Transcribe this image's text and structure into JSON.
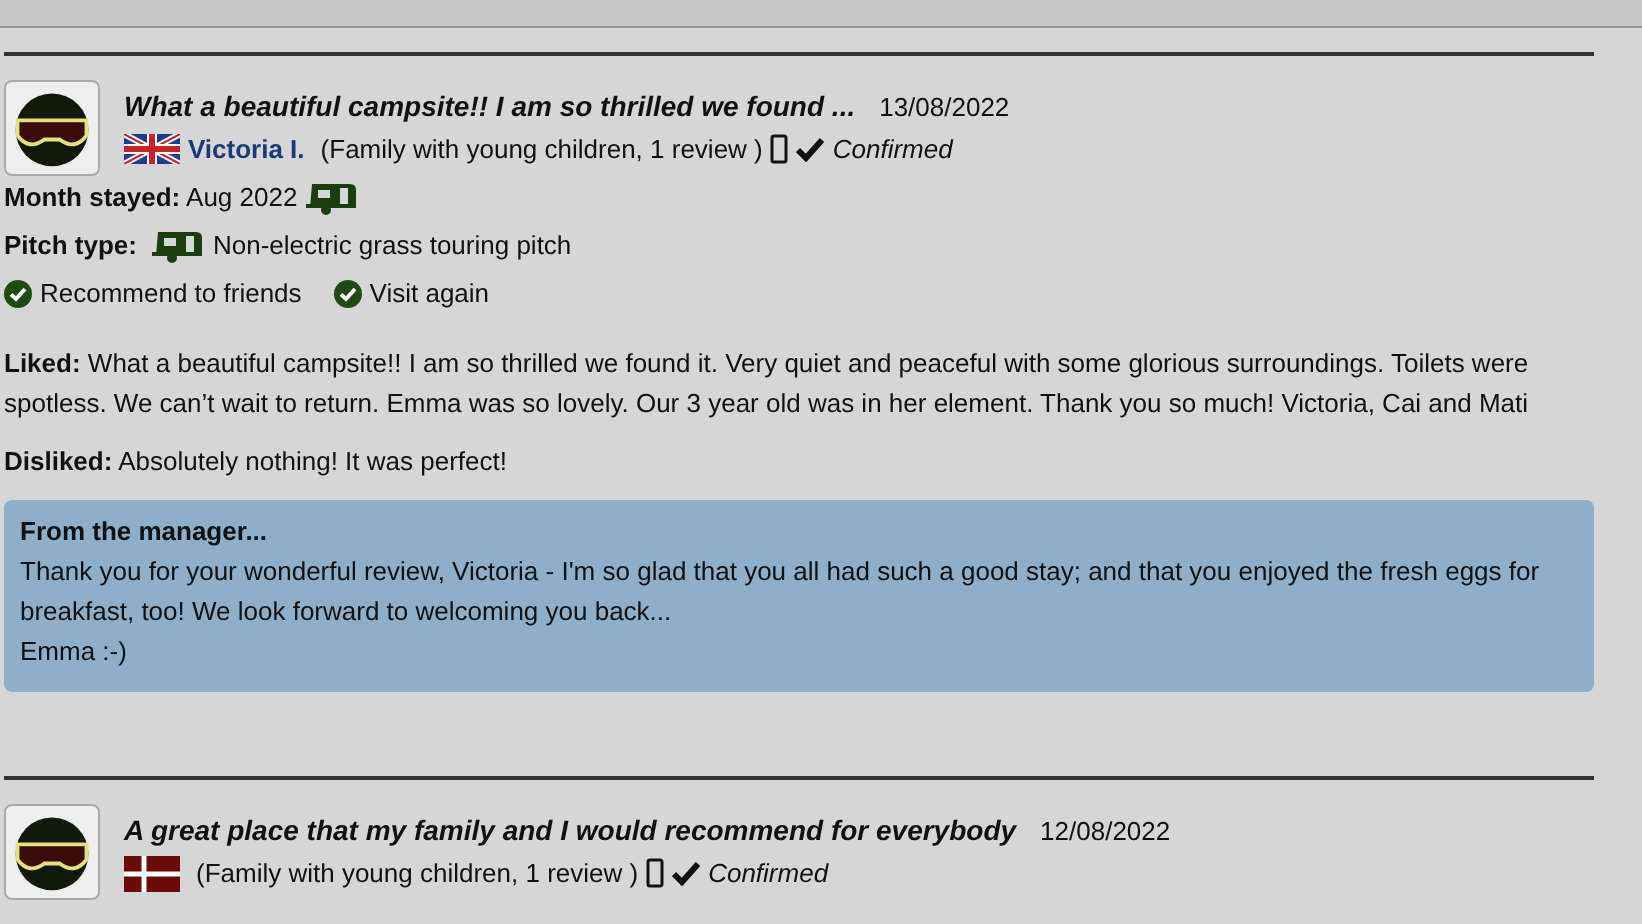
{
  "reviews": [
    {
      "title": "What a beautiful campsite!! I am so thrilled we found ...",
      "date": "13/08/2022",
      "flag": {
        "kind": "uk"
      },
      "reviewer": "Victoria I.",
      "details": "(Family with young children, 1 review )",
      "confirmed": "Confirmed",
      "month_label": "Month stayed:",
      "month": "Aug 2022",
      "pitch_label": "Pitch type:",
      "pitch": "Non-electric grass touring pitch",
      "recommends": [
        "Recommend to friends",
        "Visit again"
      ],
      "liked_label": "Liked:",
      "liked": "What a beautiful campsite!! I am so thrilled we found it. Very quiet and peaceful with some glorious surroundings. Toilets were spotless. We can’t wait to return. Emma was so lovely. Our 3 year old was in her element. Thank you so much! Victoria, Cai and Mati",
      "disliked_label": "Disliked:",
      "disliked": "Absolutely nothing! It was perfect!",
      "manager_title": "From the manager...",
      "manager_reply": "Thank you for your wonderful review, Victoria - I'm so glad that you all had such a good stay; and that you enjoyed the fresh eggs for breakfast, too! We look forward to welcoming you back...",
      "manager_sign": "Emma :-)"
    },
    {
      "title": "A great place that my family and I would recommend for everybody",
      "date": "12/08/2022",
      "flag": {
        "kind": "denmark"
      },
      "details": "(Family with young children, 1 review )",
      "confirmed": "Confirmed"
    }
  ]
}
